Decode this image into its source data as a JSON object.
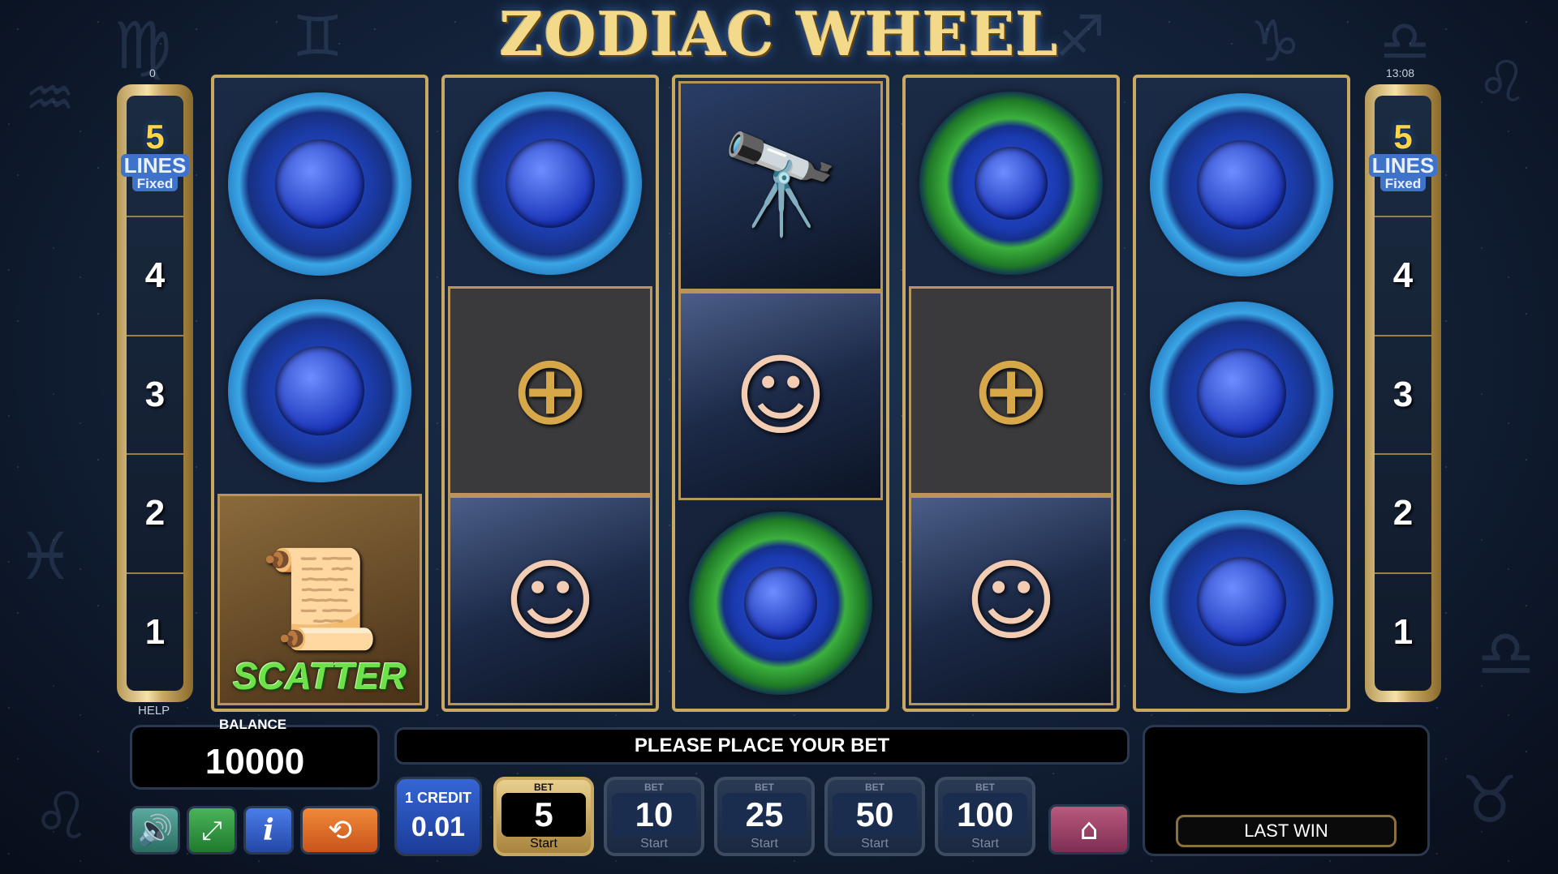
{
  "header": {
    "title": "ZODIAC WHEEL",
    "left_counter": "0",
    "clock": "13:08"
  },
  "lines_panel": {
    "count": "5",
    "label": "LINES",
    "mode": "Fixed",
    "numbers": [
      "4",
      "3",
      "2",
      "1"
    ]
  },
  "reels": [
    [
      "blue-ring",
      "blue-ring",
      "scatter-map"
    ],
    [
      "blue-ring",
      "armillary-sphere",
      "lady-with-lantern"
    ],
    [
      "telescope",
      "lady-with-lantern",
      "green-ring"
    ],
    [
      "green-ring",
      "armillary-sphere",
      "lady-with-lantern"
    ],
    [
      "blue-ring",
      "blue-ring",
      "blue-ring"
    ]
  ],
  "scatter_label": "SCATTER",
  "help_label": "HELP",
  "balance": {
    "label": "BALANCE",
    "value": "10000"
  },
  "message": "PLEASE PLACE YOUR BET",
  "last_win": {
    "label": "LAST WIN"
  },
  "credit": {
    "label": "1 CREDIT",
    "value": "0.01"
  },
  "bets": [
    {
      "tag": "BET",
      "value": "5",
      "start": "Start",
      "active": true
    },
    {
      "tag": "BET",
      "value": "10",
      "start": "Start",
      "active": false
    },
    {
      "tag": "BET",
      "value": "25",
      "start": "Start",
      "active": false
    },
    {
      "tag": "BET",
      "value": "50",
      "start": "Start",
      "active": false
    },
    {
      "tag": "BET",
      "value": "100",
      "start": "Start",
      "active": false
    }
  ],
  "icons": {
    "sound": "speaker-icon",
    "fullscreen": "fullscreen-icon",
    "info": "info-icon",
    "autoplay": "autoplay-icon",
    "home": "home-icon"
  },
  "colors": {
    "gold": "#c9a862",
    "background": "#14243c",
    "scatter_text": "#6de04a",
    "lines_number": "#ffd64a"
  }
}
